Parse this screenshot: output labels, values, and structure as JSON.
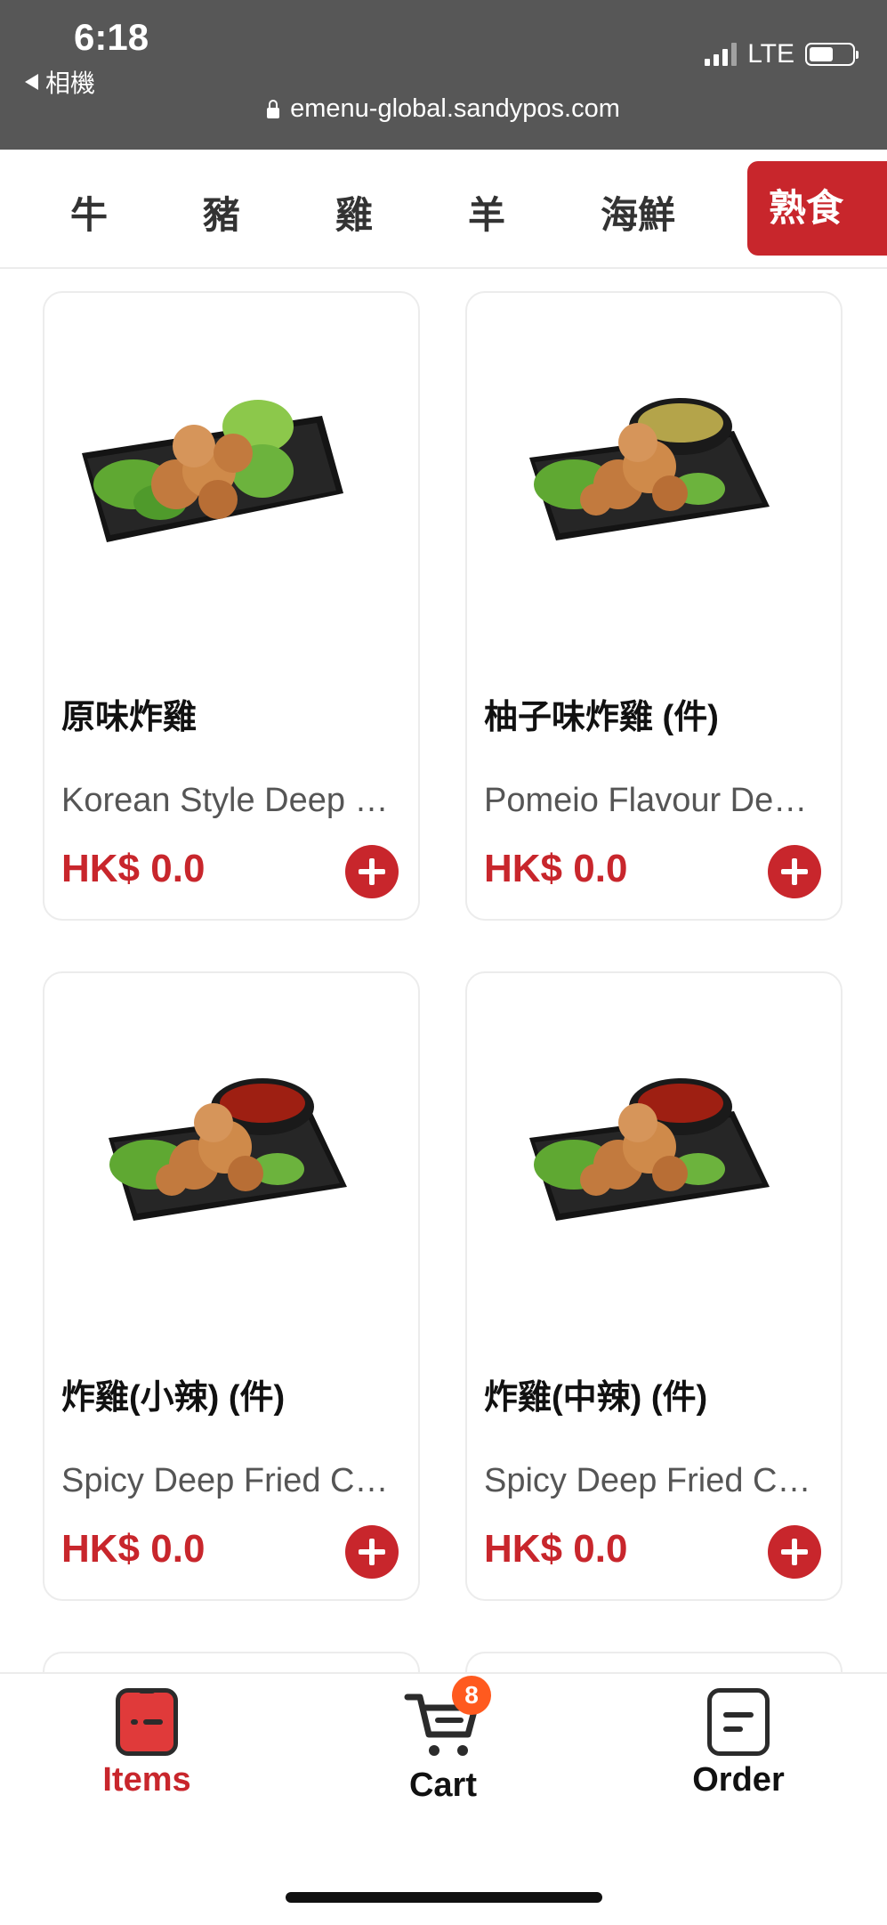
{
  "status": {
    "time": "6:18",
    "back_label": "相機",
    "network": "LTE",
    "url": "emenu-global.sandypos.com"
  },
  "categories": {
    "items": [
      "牛",
      "豬",
      "雞",
      "羊",
      "海鮮"
    ],
    "active": "熟食類"
  },
  "products": [
    {
      "name": "原味炸雞",
      "desc": "Korean Style Deep Fried Chicken",
      "price": "HK$ 0.0",
      "sauce": "none"
    },
    {
      "name": "柚子味炸雞 (件)",
      "desc": "Pomeio Flavour Deep Fried Chicken",
      "price": "HK$ 0.0",
      "sauce": "yuzu"
    },
    {
      "name": "炸雞(小辣) (件)",
      "desc": "Spicy Deep Fried Chicken (Mild)",
      "price": "HK$ 0.0",
      "sauce": "chili"
    },
    {
      "name": "炸雞(中辣) (件)",
      "desc": "Spicy Deep Fried Chicken (Medium)",
      "price": "HK$ 0.0",
      "sauce": "chili"
    }
  ],
  "nav": {
    "items_label": "Items",
    "cart_label": "Cart",
    "cart_count": "8",
    "order_label": "Order"
  },
  "colors": {
    "accent": "#c8262c",
    "badge": "#ff5a1f"
  }
}
